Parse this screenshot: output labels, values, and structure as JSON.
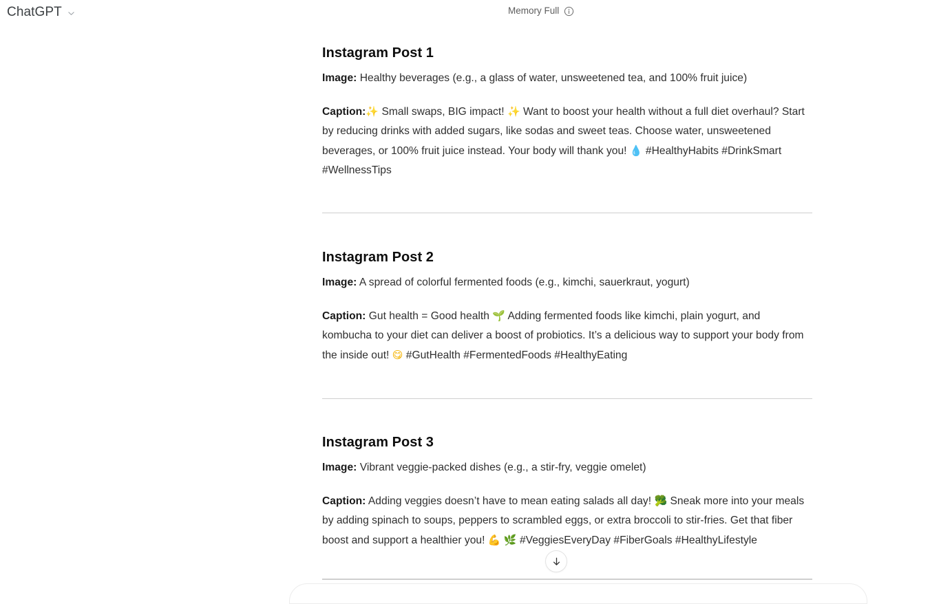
{
  "topbar": {
    "brand": "ChatGPT",
    "brand_chevron_icon": "chevron-down-icon",
    "memory_status": "Memory Full",
    "memory_info_icon": "info-circle-icon"
  },
  "conversation": {
    "posts": [
      {
        "title": "Instagram Post 1",
        "image_label": "Image:",
        "image_text": " Healthy beverages (e.g., a glass of water, unsweetened tea, and 100% fruit juice)",
        "caption_label": "Caption:",
        "caption_parts": [
          {
            "type": "emoji",
            "glyph": "✨",
            "name": "sparkles-emoji",
            "cls": "em-spark"
          },
          {
            "type": "text",
            "text": " Small swaps, BIG impact! "
          },
          {
            "type": "emoji",
            "glyph": "✨",
            "name": "sparkles-emoji",
            "cls": "em-spark"
          },
          {
            "type": "text",
            "text": " Want to boost your health without a full diet overhaul? Start by reducing drinks with added sugars, like sodas and sweet teas. Choose water, unsweetened beverages, or 100% fruit juice instead. Your body will thank you! "
          },
          {
            "type": "emoji",
            "glyph": "💧",
            "name": "droplet-emoji",
            "cls": "em-drop"
          },
          {
            "type": "text",
            "text": " #HealthyHabits #DrinkSmart #WellnessTips"
          }
        ]
      },
      {
        "title": "Instagram Post 2",
        "image_label": "Image:",
        "image_text": " A spread of colorful fermented foods (e.g., kimchi, sauerkraut, yogurt)",
        "caption_label": "Caption:",
        "caption_parts": [
          {
            "type": "text",
            "text": " Gut health = Good health "
          },
          {
            "type": "emoji",
            "glyph": "🌱",
            "name": "seedling-emoji",
            "cls": "em-sprout"
          },
          {
            "type": "text",
            "text": " Adding fermented foods like kimchi, plain yogurt, and kombucha to your diet can deliver a boost of probiotics. It’s a delicious way to support your body from the inside out! "
          },
          {
            "type": "emoji",
            "glyph": "😋",
            "name": "face-savoring-food-emoji",
            "cls": "em-yum"
          },
          {
            "type": "text",
            "text": " #GutHealth #FermentedFoods #HealthyEating"
          }
        ]
      },
      {
        "title": "Instagram Post 3",
        "image_label": "Image:",
        "image_text": " Vibrant veggie-packed dishes (e.g., a stir-fry, veggie omelet)",
        "caption_label": "Caption:",
        "caption_parts": [
          {
            "type": "text",
            "text": " Adding veggies doesn’t have to mean eating salads all day! "
          },
          {
            "type": "emoji",
            "glyph": "🥦",
            "name": "broccoli-emoji",
            "cls": "em-brocc"
          },
          {
            "type": "text",
            "text": " Sneak more into your meals by adding spinach to soups, peppers to scrambled eggs, or extra broccoli to stir-fries. Get that fiber boost and support a healthier you! "
          },
          {
            "type": "emoji",
            "glyph": "💪",
            "name": "flexed-biceps-emoji",
            "cls": "em-bicep"
          },
          {
            "type": "text",
            "text": " "
          },
          {
            "type": "emoji",
            "glyph": "🌿",
            "name": "herb-emoji",
            "cls": "em-herb"
          },
          {
            "type": "text",
            "text": " #VeggiesEveryDay #FiberGoals #HealthyLifestyle"
          }
        ]
      }
    ]
  },
  "controls": {
    "scroll_to_bottom_icon": "arrow-down-icon"
  }
}
